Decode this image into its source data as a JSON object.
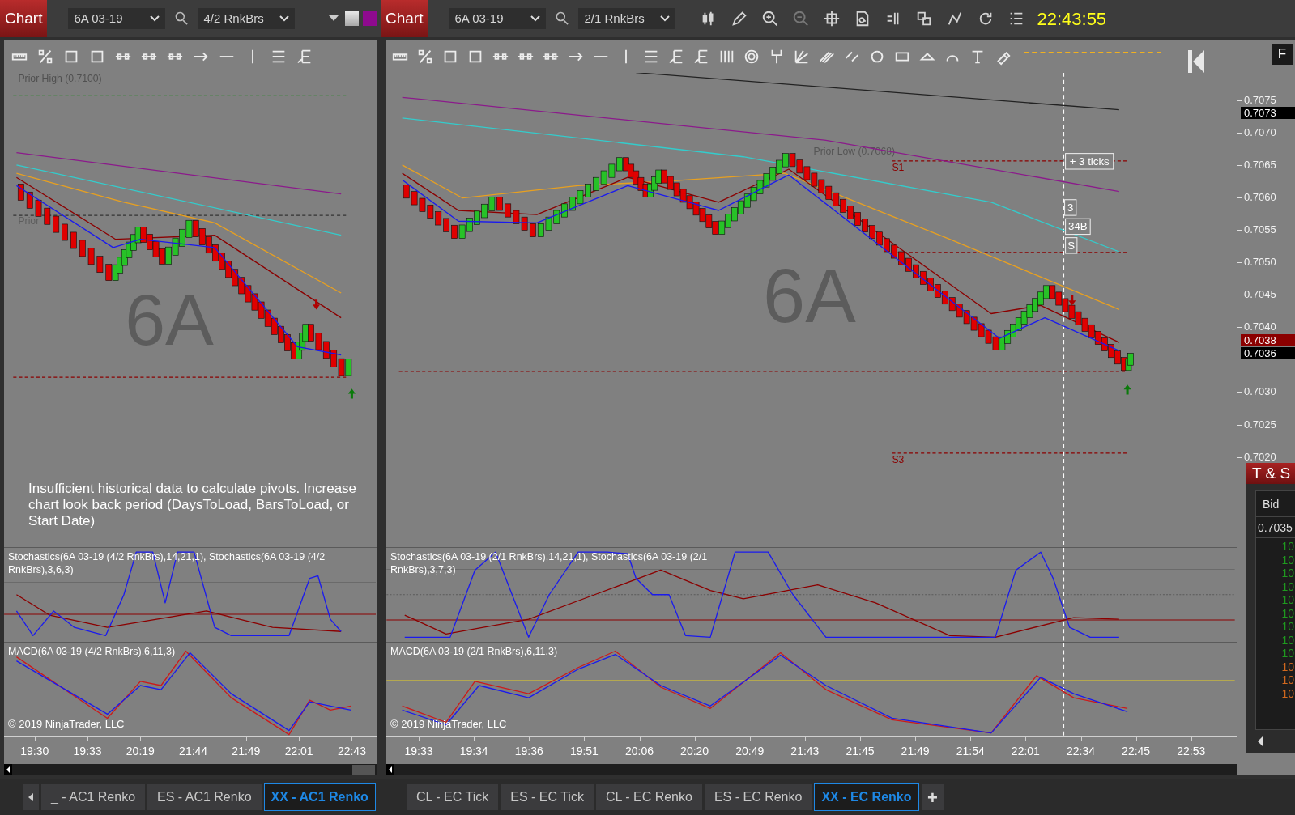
{
  "left_chart": {
    "header": {
      "title": "Chart",
      "instrument": "6A 03-19",
      "bar_type": "4/2 RnkBrs"
    },
    "price_panel": {
      "watermark": "6A",
      "labels": [
        {
          "kind": "prior_high",
          "text": "Prior High (0.7100)"
        },
        {
          "kind": "prior_low",
          "text": "Prior"
        }
      ],
      "message": "Insufficient historical data to calculate pivots. Increase chart look back period (DaysToLoad, BarsToLoad, or Start Date)"
    },
    "stochastics_label": "Stochastics(6A 03-19 (4/2 RnkBrs),14,21,1), Stochastics(6A 03-19 (4/2 RnkBrs),3,6,3)",
    "macd_label": "MACD(6A 03-19 (4/2 RnkBrs),6,11,3)",
    "copyright": "© 2019 NinjaTrader, LLC",
    "time_axis": [
      "19:30",
      "19:33",
      "20:19",
      "21:44",
      "21:49",
      "22:01",
      "22:43"
    ],
    "tabs": [
      {
        "label": "_ - AC1 Renko",
        "selected": false
      },
      {
        "label": "ES - AC1 Renko",
        "selected": false
      },
      {
        "label": "XX - AC1 Renko",
        "selected": true
      }
    ]
  },
  "right_chart": {
    "header": {
      "title": "Chart",
      "instrument": "6A 03-19",
      "bar_type": "2/1 RnkBrs"
    },
    "clock": "22:43:55",
    "price_panel": {
      "watermark": "6A",
      "labels": [
        {
          "kind": "prior_low",
          "text": "Prior Low (0.7068)"
        },
        {
          "kind": "s1",
          "text": "S1"
        },
        {
          "kind": "s3",
          "text": "S3"
        }
      ],
      "boxes": [
        "+ 3 ticks",
        "3",
        "34B",
        "S"
      ]
    },
    "price_axis": {
      "ticks": [
        "0.7075",
        "0.7070",
        "0.7065",
        "0.7060",
        "0.7055",
        "0.7050",
        "0.7045",
        "0.7040",
        "0.7030",
        "0.7025",
        "0.7020"
      ],
      "markers": [
        {
          "text": "0.7073",
          "color": "#000000"
        },
        {
          "text": "0.7038",
          "color": "#8b0000"
        },
        {
          "text": "0.7036",
          "color": "#000000"
        }
      ]
    },
    "flag": "F",
    "stochastics_label": "Stochastics(6A 03-19 (2/1 RnkBrs),14,21,1), Stochastics(6A 03-19 (2/1 RnkBrs),3,7,3)",
    "macd_label": "MACD(6A 03-19 (2/1 RnkBrs),6,11,3)",
    "copyright": "© 2019 NinjaTrader, LLC",
    "time_axis": [
      "19:33",
      "19:34",
      "19:36",
      "19:51",
      "20:06",
      "20:20",
      "20:49",
      "21:43",
      "21:45",
      "21:49",
      "21:54",
      "22:01",
      "22:34",
      "22:45",
      "22:53"
    ],
    "tabs": [
      {
        "label": "CL - EC Tick",
        "selected": false
      },
      {
        "label": "ES - EC Tick",
        "selected": false
      },
      {
        "label": "CL - EC Renko",
        "selected": false
      },
      {
        "label": "ES - EC Renko",
        "selected": false
      },
      {
        "label": "XX - EC Renko",
        "selected": true
      }
    ],
    "add_tab": "+"
  },
  "time_and_sales": {
    "title": "T & S",
    "column": "Bid",
    "price": "0.7035",
    "rows": [
      {
        "text": "10",
        "color": "#1f9a1f"
      },
      {
        "text": "10",
        "color": "#1f9a1f"
      },
      {
        "text": "10",
        "color": "#1f9a1f"
      },
      {
        "text": "10",
        "color": "#1f9a1f"
      },
      {
        "text": "10",
        "color": "#1f9a1f"
      },
      {
        "text": "10",
        "color": "#1f9a1f"
      },
      {
        "text": "10",
        "color": "#1f9a1f"
      },
      {
        "text": "10",
        "color": "#1f9a1f"
      },
      {
        "text": "10",
        "color": "#1f9a1f"
      },
      {
        "text": "10",
        "color": "#d2691e"
      },
      {
        "text": "10",
        "color": "#d2691e"
      },
      {
        "text": "10",
        "color": "#d2691e"
      }
    ]
  }
}
